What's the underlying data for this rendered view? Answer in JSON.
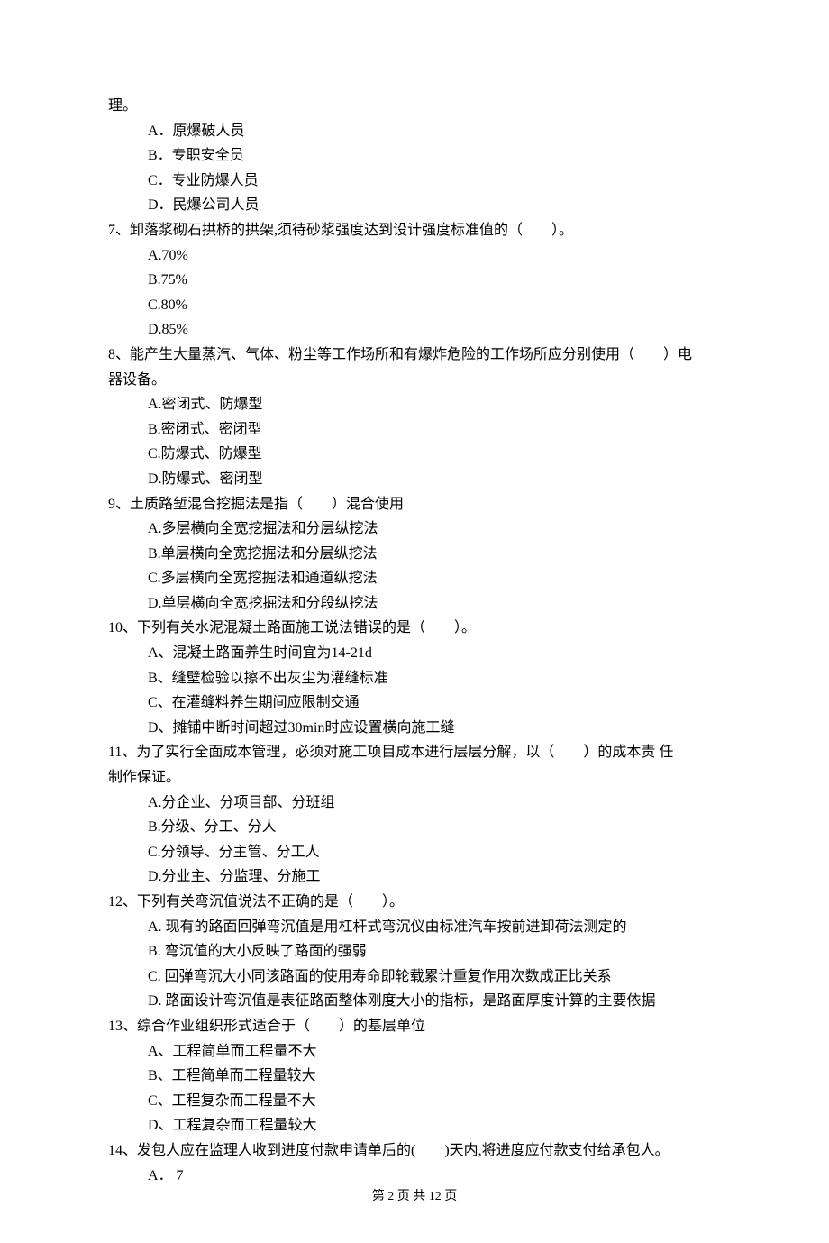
{
  "continuation": "理。",
  "q6_options": {
    "a": "A．原爆破人员",
    "b": "B．专职安全员",
    "c": "C．专业防爆人员",
    "d": "D．民爆公司人员"
  },
  "q7": {
    "stem": "7、卸落浆砌石拱桥的拱架,须待砂浆强度达到设计强度标准值的（　　）。",
    "a": "A.70%",
    "b": "B.75%",
    "c": "C.80%",
    "d": "D.85%"
  },
  "q8": {
    "stem_line1": "8、能产生大量蒸汽、气体、粉尘等工作场所和有爆炸危险的工作场所应分别使用（　　）电",
    "stem_line2": "器设备。",
    "a": "A.密闭式、防爆型",
    "b": "B.密闭式、密闭型",
    "c": "C.防爆式、防爆型",
    "d": "D.防爆式、密闭型"
  },
  "q9": {
    "stem": "9、土质路堑混合挖掘法是指（　　）混合使用",
    "a": "A.多层横向全宽挖掘法和分层纵挖法",
    "b": "B.单层横向全宽挖掘法和分层纵挖法",
    "c": "C.多层横向全宽挖掘法和通道纵挖法",
    "d": "D.单层横向全宽挖掘法和分段纵挖法"
  },
  "q10": {
    "stem": "10、下列有关水泥混凝土路面施工说法错误的是（　　）。",
    "a": "A、混凝土路面养生时间宜为14-21d",
    "b": "B、缝壁检验以擦不出灰尘为灌缝标准",
    "c": "C、在灌缝料养生期间应限制交通",
    "d": "D、摊铺中断时间超过30min时应设置横向施工缝"
  },
  "q11": {
    "stem_line1": "11、为了实行全面成本管理，必须对施工项目成本进行层层分解，以（　　）的成本责 任",
    "stem_line2": "制作保证。",
    "a": "A.分企业、分项目部、分班组",
    "b": "B.分级、分工、分人",
    "c": "C.分领导、分主管、分工人",
    "d": "D.分业主、分监理、分施工"
  },
  "q12": {
    "stem": "12、下列有关弯沉值说法不正确的是（　　）。",
    "a": "A. 现有的路面回弹弯沉值是用杠杆式弯沉仪由标准汽车按前进卸荷法测定的",
    "b": "B. 弯沉值的大小反映了路面的强弱",
    "c": "C. 回弹弯沉大小同该路面的使用寿命即轮载累计重复作用次数成正比关系",
    "d": "D. 路面设计弯沉值是表征路面整体刚度大小的指标，是路面厚度计算的主要依据"
  },
  "q13": {
    "stem": "13、综合作业组织形式适合于（　　）的基层单位",
    "a": "A、工程简单而工程量不大",
    "b": "B、工程简单而工程量较大",
    "c": "C、工程复杂而工程量不大",
    "d": "D、工程复杂而工程量较大"
  },
  "q14": {
    "stem": "14、发包人应在监理人收到进度付款申请单后的(　　)天内,将进度应付款支付给承包人。",
    "a": "A． 7"
  },
  "footer": "第 2 页 共 12 页"
}
